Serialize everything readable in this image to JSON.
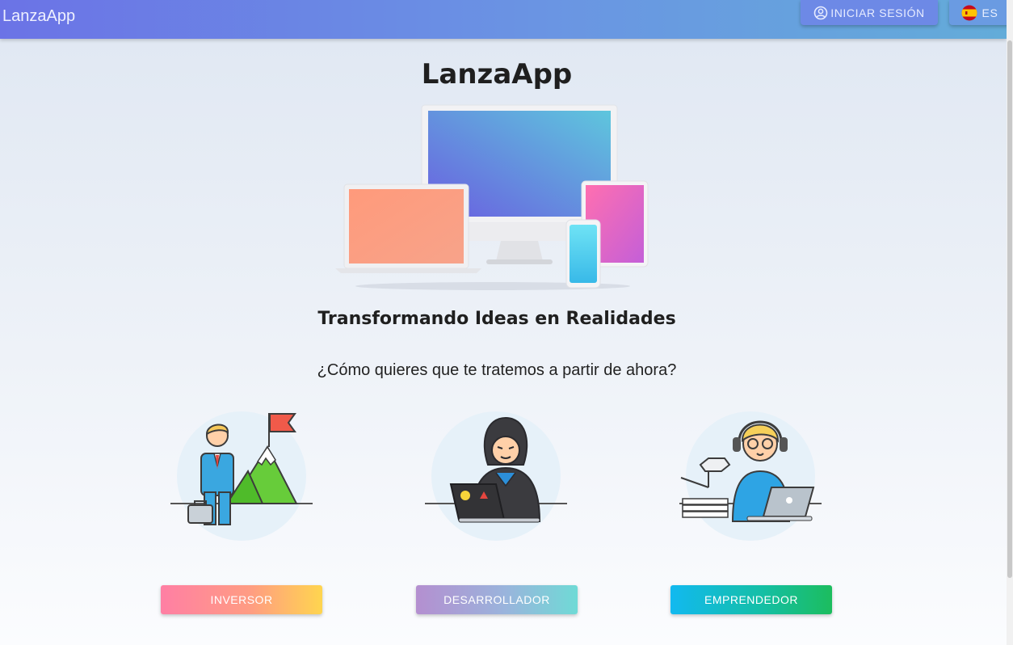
{
  "header": {
    "brand": "LanzaApp",
    "login_label": "INICIAR SESIÓN",
    "language_label": "ES"
  },
  "main": {
    "title": "LanzaApp",
    "subtitle": "Transformando Ideas en Realidades",
    "question": "¿Cómo quieres que te tratemos a partir de ahora?"
  },
  "roles": [
    {
      "label": "INVERSOR",
      "icon": "investor-illustration"
    },
    {
      "label": "DESARROLLADOR",
      "icon": "developer-illustration"
    },
    {
      "label": "EMPRENDEDOR",
      "icon": "entrepreneur-illustration"
    }
  ],
  "colors": {
    "header_start": "#6b73e6",
    "header_end": "#63acd9",
    "inversor_gradient": [
      "#ff7fa4",
      "#ffd54f"
    ],
    "desarrollador_gradient": [
      "#b48fd0",
      "#6fdad6"
    ],
    "emprendedor_gradient": [
      "#12b9f0",
      "#1cbd5e"
    ]
  }
}
